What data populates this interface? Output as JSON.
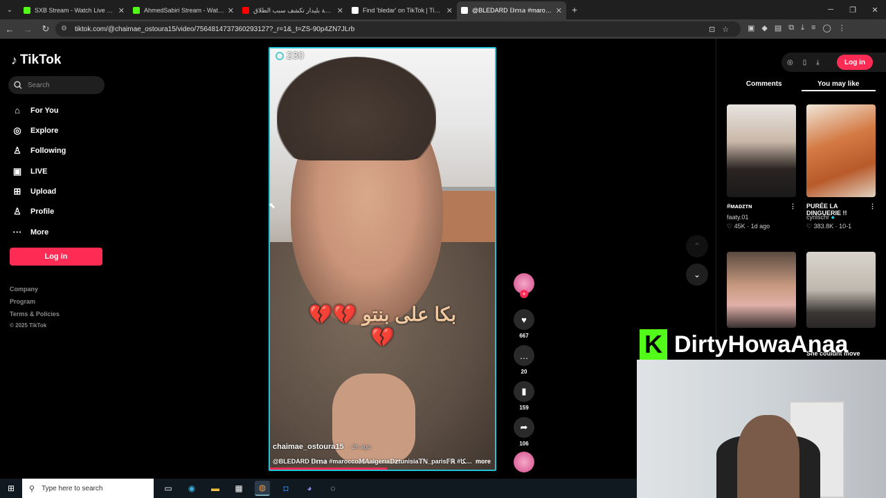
{
  "browser": {
    "tabs": [
      {
        "title": "SXB Stream - Watch Live on Kick",
        "color": "#53fc18"
      },
      {
        "title": "AhmedSabiri Stream - Watch Live",
        "color": "#53fc18"
      },
      {
        "title": "زوجة بليدار تكشف سبب الطلاق",
        "color": "#ff0000"
      },
      {
        "title": "Find 'bledar' on TikTok | TikTok",
        "color": "#ffffff"
      },
      {
        "title": "@BLEDARD 𝔻𝕞𝕒 #marocco",
        "color": "#ffffff",
        "active": true
      }
    ],
    "url": "tiktok.com/@chaimae_ostoura15/video/7564814737360293127?_r=1&_t=ZS-90p4ZN7JLrb"
  },
  "sidebar": {
    "logo": "TikTok",
    "search_placeholder": "Search",
    "items": [
      {
        "label": "For You",
        "icon": "home-icon",
        "glyph": "⌂"
      },
      {
        "label": "Explore",
        "icon": "compass-icon",
        "glyph": "◎"
      },
      {
        "label": "Following",
        "icon": "user-icon",
        "glyph": "♙"
      },
      {
        "label": "LIVE",
        "icon": "live-icon",
        "glyph": "▣"
      },
      {
        "label": "Upload",
        "icon": "plus-square-icon",
        "glyph": "⊞"
      },
      {
        "label": "Profile",
        "icon": "profile-icon",
        "glyph": "♙"
      },
      {
        "label": "More",
        "icon": "dots-icon",
        "glyph": "···"
      }
    ],
    "login_label": "Log in",
    "footer": [
      "Company",
      "Program",
      "Terms & Policies"
    ],
    "copyright": "© 2025 TikTok"
  },
  "video": {
    "view_count": "230",
    "arabic_caption": "بكا على بنتو",
    "author": "chaimae_ostoura15",
    "time_ago": "· 2h ago",
    "description": "@BLEDARD 𝔻𝕞𝕒 #marocco𝕄𝔸algeria𝔻𝕫tunisia𝕋ℕ_paris𝔽ℝ #إلهة_بلجيكا ...",
    "more_label": "more",
    "progress_fraction": 0.52
  },
  "actions": {
    "likes": "667",
    "comments": "20",
    "saves": "159",
    "shares": "106"
  },
  "right_panel": {
    "login_label": "Log in",
    "tabs": [
      "Comments",
      "You may like"
    ],
    "active_tab": 1,
    "cards": [
      {
        "title": "#ᴍᴀᴅᴢᴛɴ",
        "user": "faaty.01",
        "likes": "45K",
        "age": "1d ago"
      },
      {
        "title": "PURÉE LA DINGUERIE !!",
        "user": "cyrilschr",
        "likes": "383.8K",
        "age": "10-1"
      }
    ],
    "bottom_caption": "She couldnt move"
  },
  "overlay": {
    "brand_letter": "K",
    "streamer_name": "DirtyHowaAnaa"
  },
  "taskbar": {
    "search_placeholder": "Type here to search"
  }
}
